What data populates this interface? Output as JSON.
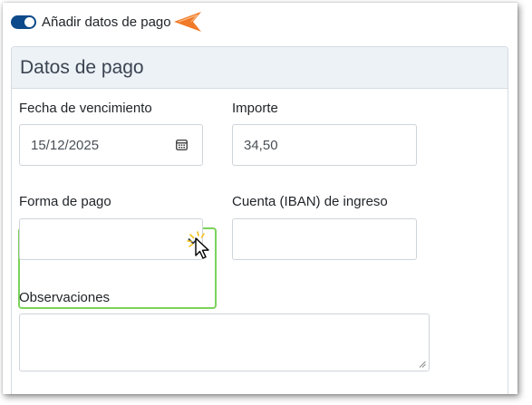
{
  "toggle": {
    "label": "Añadir datos de pago",
    "checked": true,
    "color": "#0d4a8a"
  },
  "card": {
    "title": "Datos de pago"
  },
  "fields": {
    "due_date": {
      "label": "Fecha de vencimiento",
      "value": "15/12/2025"
    },
    "amount": {
      "label": "Importe",
      "value": "34,50"
    },
    "payment_method": {
      "label": "Forma de pago",
      "value": ""
    },
    "iban": {
      "label": "Cuenta (IBAN) de ingreso",
      "value": ""
    },
    "notes": {
      "label": "Observaciones",
      "value": ""
    }
  },
  "colors": {
    "highlight": "#7bd35c",
    "arrow": "#f07a28"
  },
  "icons": [
    "calendar-icon",
    "chevron-down-icon",
    "cursor-icon",
    "pointer-arrow-icon",
    "resize-handle-icon"
  ]
}
